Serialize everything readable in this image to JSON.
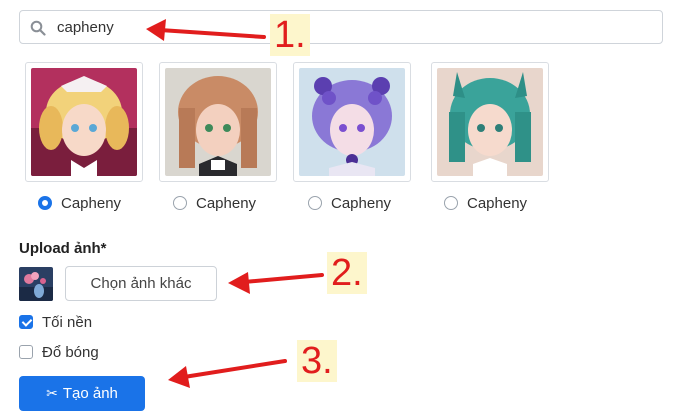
{
  "search": {
    "value": "capheny"
  },
  "skins": [
    {
      "label": "Capheny",
      "selected": true
    },
    {
      "label": "Capheny",
      "selected": false
    },
    {
      "label": "Capheny",
      "selected": false
    },
    {
      "label": "Capheny",
      "selected": false
    }
  ],
  "upload": {
    "title": "Upload ảnh*",
    "choose_label": "Chọn ảnh khác"
  },
  "options": {
    "background": {
      "label": "Tối nền",
      "checked": true
    },
    "shadow": {
      "label": "Đổ bóng",
      "checked": false
    }
  },
  "create_button": {
    "label": "Tạo ảnh"
  },
  "annotations": [
    "1.",
    "2.",
    "3."
  ],
  "colors": {
    "accent": "#1a73e8",
    "annotation": "#e11d1d"
  }
}
